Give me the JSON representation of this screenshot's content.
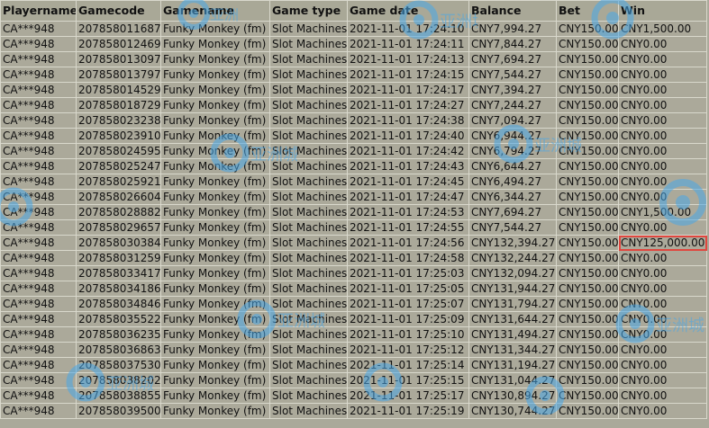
{
  "columns": [
    "Playername",
    "Gamecode",
    "Gamename",
    "Game type",
    "Game date",
    "Balance",
    "Bet",
    "Win"
  ],
  "rows": [
    [
      "CA***948",
      "207858011687",
      "Funky Monkey (fm)",
      "Slot Machines",
      "2021-11-01 17:24:10",
      "CNY7,994.27",
      "CNY150.00",
      "CNY1,500.00"
    ],
    [
      "CA***948",
      "207858012469",
      "Funky Monkey (fm)",
      "Slot Machines",
      "2021-11-01 17:24:11",
      "CNY7,844.27",
      "CNY150.00",
      "CNY0.00"
    ],
    [
      "CA***948",
      "207858013097",
      "Funky Monkey (fm)",
      "Slot Machines",
      "2021-11-01 17:24:13",
      "CNY7,694.27",
      "CNY150.00",
      "CNY0.00"
    ],
    [
      "CA***948",
      "207858013797",
      "Funky Monkey (fm)",
      "Slot Machines",
      "2021-11-01 17:24:15",
      "CNY7,544.27",
      "CNY150.00",
      "CNY0.00"
    ],
    [
      "CA***948",
      "207858014529",
      "Funky Monkey (fm)",
      "Slot Machines",
      "2021-11-01 17:24:17",
      "CNY7,394.27",
      "CNY150.00",
      "CNY0.00"
    ],
    [
      "CA***948",
      "207858018729",
      "Funky Monkey (fm)",
      "Slot Machines",
      "2021-11-01 17:24:27",
      "CNY7,244.27",
      "CNY150.00",
      "CNY0.00"
    ],
    [
      "CA***948",
      "207858023238",
      "Funky Monkey (fm)",
      "Slot Machines",
      "2021-11-01 17:24:38",
      "CNY7,094.27",
      "CNY150.00",
      "CNY0.00"
    ],
    [
      "CA***948",
      "207858023910",
      "Funky Monkey (fm)",
      "Slot Machines",
      "2021-11-01 17:24:40",
      "CNY6,944.27",
      "CNY150.00",
      "CNY0.00"
    ],
    [
      "CA***948",
      "207858024595",
      "Funky Monkey (fm)",
      "Slot Machines",
      "2021-11-01 17:24:42",
      "CNY6,794.27",
      "CNY150.00",
      "CNY0.00"
    ],
    [
      "CA***948",
      "207858025247",
      "Funky Monkey (fm)",
      "Slot Machines",
      "2021-11-01 17:24:43",
      "CNY6,644.27",
      "CNY150.00",
      "CNY0.00"
    ],
    [
      "CA***948",
      "207858025921",
      "Funky Monkey (fm)",
      "Slot Machines",
      "2021-11-01 17:24:45",
      "CNY6,494.27",
      "CNY150.00",
      "CNY0.00"
    ],
    [
      "CA***948",
      "207858026604",
      "Funky Monkey (fm)",
      "Slot Machines",
      "2021-11-01 17:24:47",
      "CNY6,344.27",
      "CNY150.00",
      "CNY0.00"
    ],
    [
      "CA***948",
      "207858028882",
      "Funky Monkey (fm)",
      "Slot Machines",
      "2021-11-01 17:24:53",
      "CNY7,694.27",
      "CNY150.00",
      "CNY1,500.00"
    ],
    [
      "CA***948",
      "207858029657",
      "Funky Monkey (fm)",
      "Slot Machines",
      "2021-11-01 17:24:55",
      "CNY7,544.27",
      "CNY150.00",
      "CNY0.00"
    ],
    [
      "CA***948",
      "207858030384",
      "Funky Monkey (fm)",
      "Slot Machines",
      "2021-11-01 17:24:56",
      "CNY132,394.27",
      "CNY150.00",
      "CNY125,000.00"
    ],
    [
      "CA***948",
      "207858031259",
      "Funky Monkey (fm)",
      "Slot Machines",
      "2021-11-01 17:24:58",
      "CNY132,244.27",
      "CNY150.00",
      "CNY0.00"
    ],
    [
      "CA***948",
      "207858033417",
      "Funky Monkey (fm)",
      "Slot Machines",
      "2021-11-01 17:25:03",
      "CNY132,094.27",
      "CNY150.00",
      "CNY0.00"
    ],
    [
      "CA***948",
      "207858034186",
      "Funky Monkey (fm)",
      "Slot Machines",
      "2021-11-01 17:25:05",
      "CNY131,944.27",
      "CNY150.00",
      "CNY0.00"
    ],
    [
      "CA***948",
      "207858034846",
      "Funky Monkey (fm)",
      "Slot Machines",
      "2021-11-01 17:25:07",
      "CNY131,794.27",
      "CNY150.00",
      "CNY0.00"
    ],
    [
      "CA***948",
      "207858035522",
      "Funky Monkey (fm)",
      "Slot Machines",
      "2021-11-01 17:25:09",
      "CNY131,644.27",
      "CNY150.00",
      "CNY0.00"
    ],
    [
      "CA***948",
      "207858036235",
      "Funky Monkey (fm)",
      "Slot Machines",
      "2021-11-01 17:25:10",
      "CNY131,494.27",
      "CNY150.00",
      "CNY0.00"
    ],
    [
      "CA***948",
      "207858036863",
      "Funky Monkey (fm)",
      "Slot Machines",
      "2021-11-01 17:25:12",
      "CNY131,344.27",
      "CNY150.00",
      "CNY0.00"
    ],
    [
      "CA***948",
      "207858037530",
      "Funky Monkey (fm)",
      "Slot Machines",
      "2021-11-01 17:25:14",
      "CNY131,194.27",
      "CNY150.00",
      "CNY0.00"
    ],
    [
      "CA***948",
      "207858038202",
      "Funky Monkey (fm)",
      "Slot Machines",
      "2021-11-01 17:25:15",
      "CNY131,044.27",
      "CNY150.00",
      "CNY0.00"
    ],
    [
      "CA***948",
      "207858038855",
      "Funky Monkey (fm)",
      "Slot Machines",
      "2021-11-01 17:25:17",
      "CNY130,894.27",
      "CNY150.00",
      "CNY0.00"
    ],
    [
      "CA***948",
      "207858039500",
      "Funky Monkey (fm)",
      "Slot Machines",
      "2021-11-01 17:25:19",
      "CNY130,744.27",
      "CNY150.00",
      "CNY0.00"
    ]
  ],
  "highlight": {
    "row": 14,
    "column": 7,
    "color": "#e0473f"
  },
  "watermark": {
    "text": "亚洲城",
    "icon": "watermark-logo-icon",
    "color": "#4aa8e8"
  },
  "colors": {
    "background": "#aba99a",
    "grid": "#d9d8cc",
    "text": "#111111"
  }
}
